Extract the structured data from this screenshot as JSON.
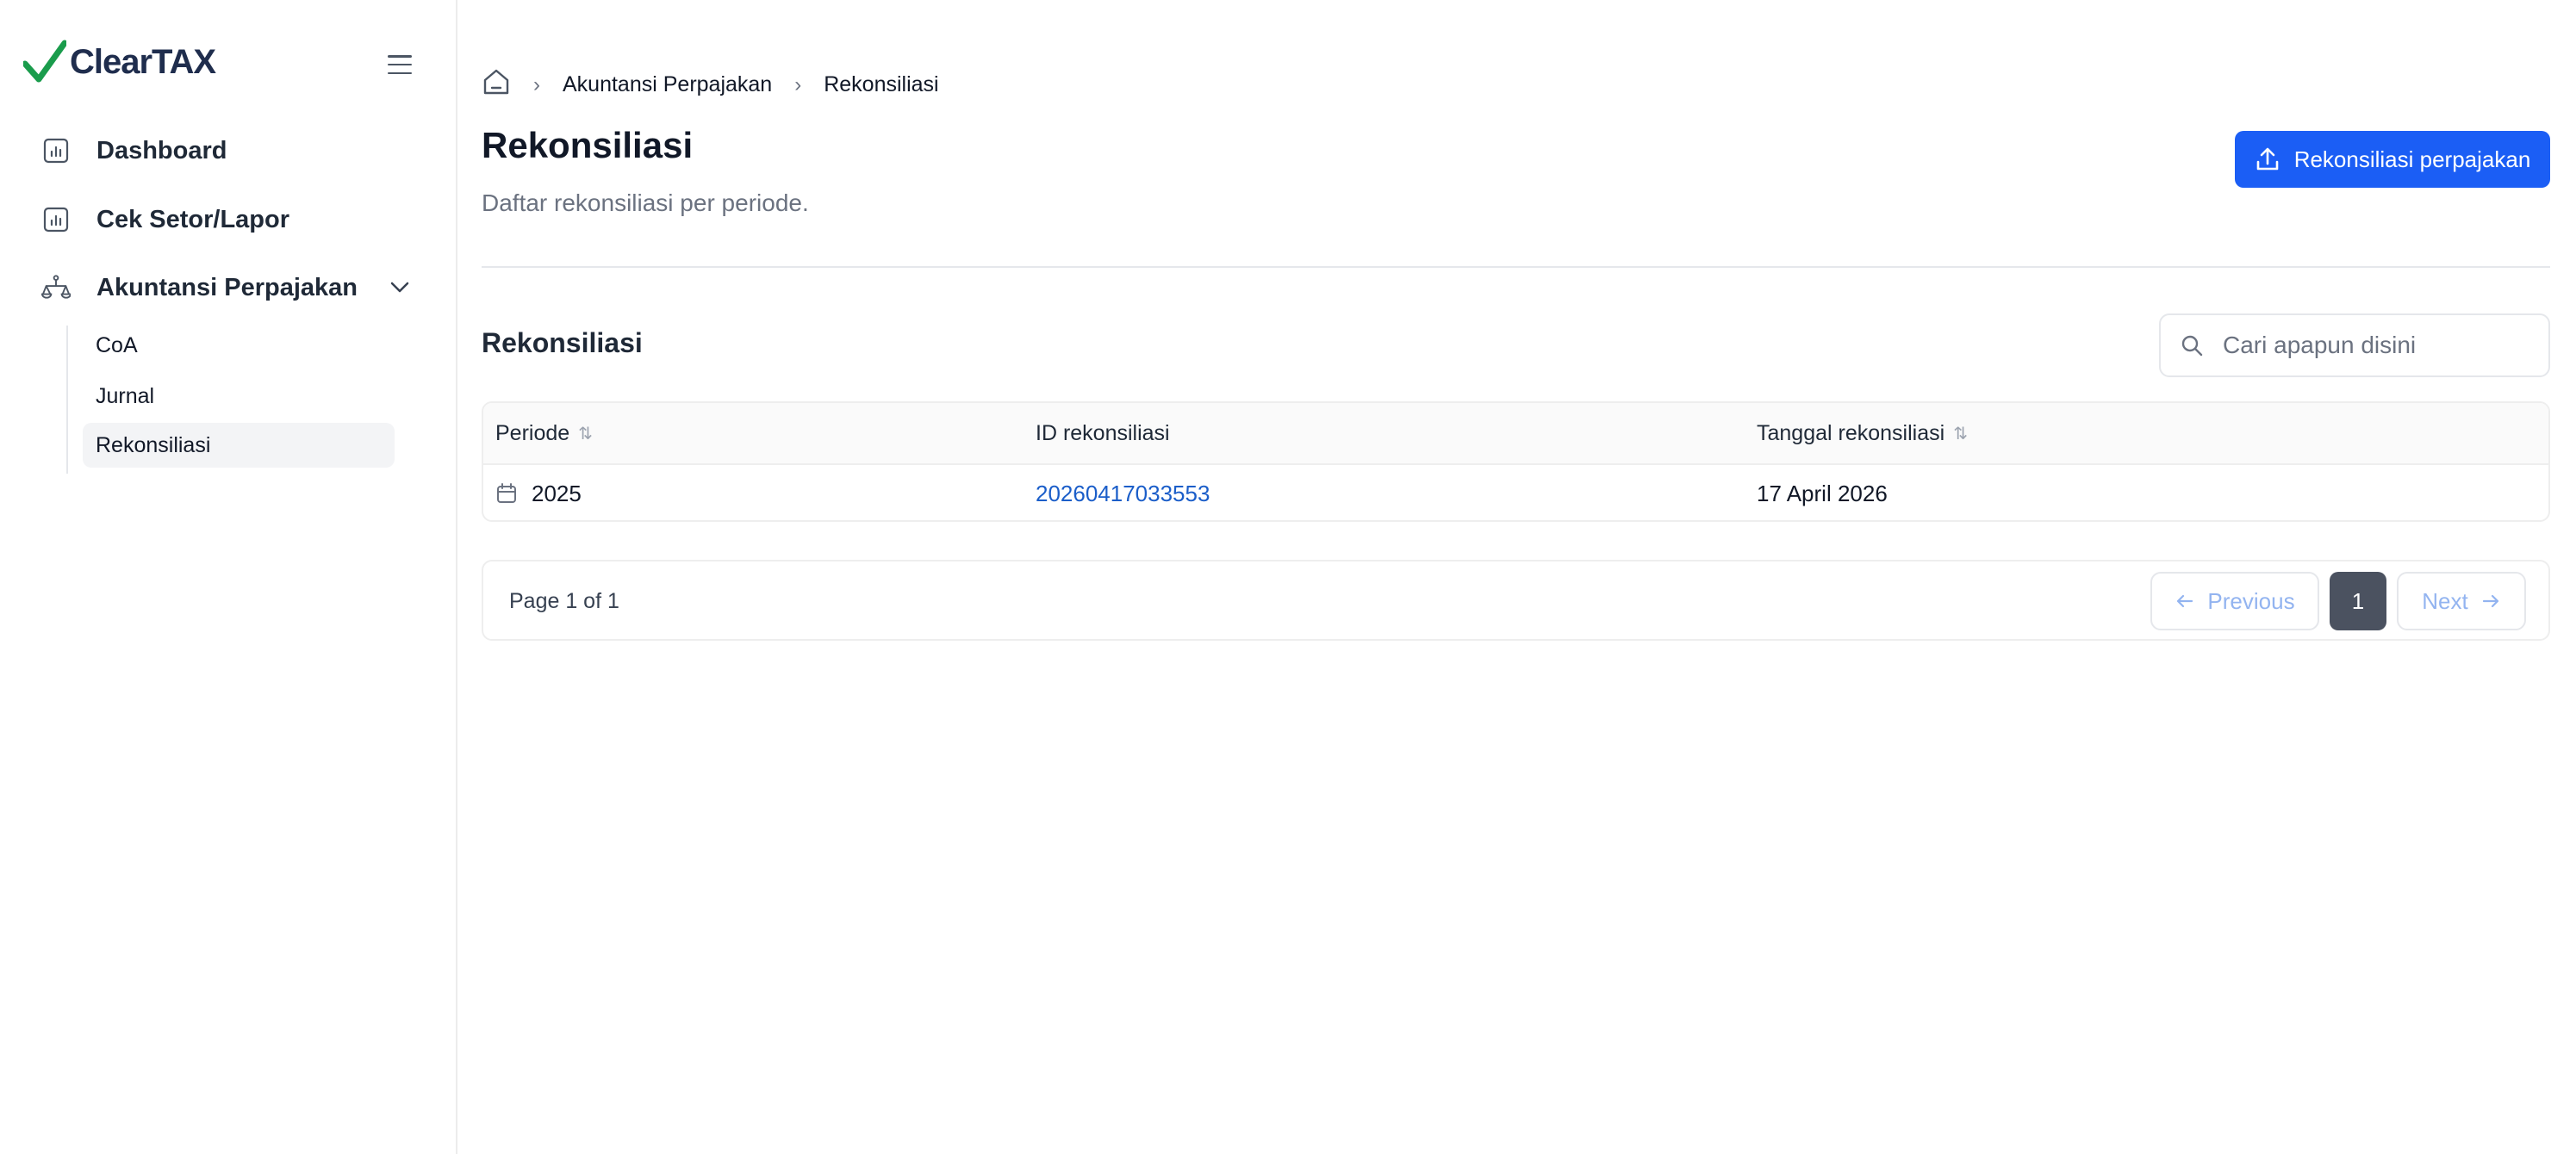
{
  "brand": {
    "name": "ClearTAX",
    "check_color": "#1a9c4c"
  },
  "sidebar": {
    "items": [
      {
        "label": "Dashboard",
        "icon": "bar-chart-icon"
      },
      {
        "label": "Cek Setor/Lapor",
        "icon": "bar-chart-icon"
      },
      {
        "label": "Akuntansi Perpajakan",
        "icon": "scale-icon"
      }
    ],
    "subitems": [
      {
        "label": "CoA"
      },
      {
        "label": "Jurnal"
      },
      {
        "label": "Rekonsiliasi",
        "active": true
      }
    ]
  },
  "breadcrumb": {
    "parent": "Akuntansi Perpajakan",
    "current": "Rekonsiliasi"
  },
  "header": {
    "title": "Rekonsiliasi",
    "subtitle": "Daftar rekonsiliasi per periode.",
    "primary_button": "Rekonsiliasi perpajakan"
  },
  "section": {
    "title": "Rekonsiliasi"
  },
  "search": {
    "placeholder": "Cari apapun disini"
  },
  "table": {
    "columns": [
      "Periode",
      "ID rekonsiliasi",
      "Tanggal rekonsiliasi"
    ],
    "rows": [
      {
        "periode": "2025",
        "id": "20260417033553",
        "tanggal": "17 April 2026"
      }
    ]
  },
  "pagination": {
    "text": "Page 1 of 1",
    "previous": "Previous",
    "next": "Next",
    "current_page": "1"
  },
  "colors": {
    "primary": "#1b5ef5",
    "link": "#1b5ec9",
    "page_active": "#4b5260"
  }
}
